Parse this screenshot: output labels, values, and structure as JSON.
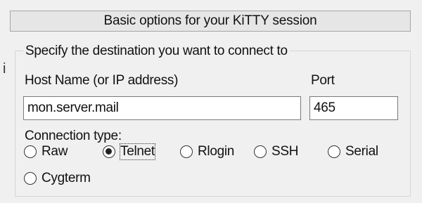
{
  "side_mark": "i",
  "header": {
    "title": "Basic options for your KiTTY session"
  },
  "destination": {
    "caption": "Specify the destination you want to connect to",
    "host_label": "Host Name (or IP address)",
    "host_value": "mon.server.mail",
    "port_label": "Port",
    "port_value": "465"
  },
  "connection": {
    "label": "Connection type:",
    "options": [
      {
        "label": "Raw",
        "checked": false
      },
      {
        "label": "Telnet",
        "checked": true
      },
      {
        "label": "Rlogin",
        "checked": false
      },
      {
        "label": "SSH",
        "checked": false
      },
      {
        "label": "Serial",
        "checked": false
      },
      {
        "label": "Cygterm",
        "checked": false
      }
    ]
  }
}
